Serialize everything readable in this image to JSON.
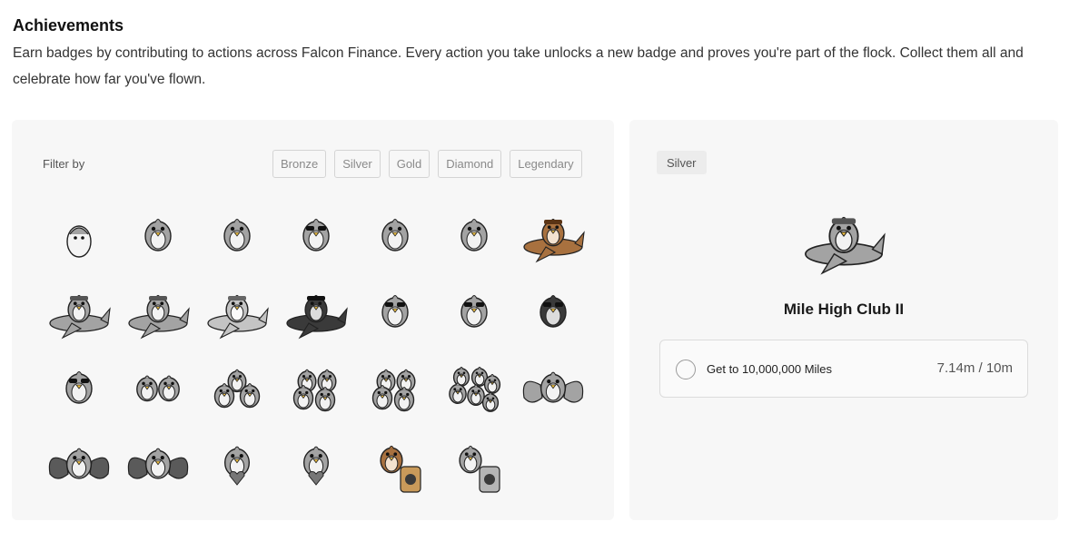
{
  "page": {
    "title": "Achievements",
    "description": "Earn badges by contributing to actions across Falcon Finance. Every action you take unlocks a new badge and proves you're part of the flock. Collect them all and celebrate how far you've flown."
  },
  "filter": {
    "label": "Filter by",
    "options": [
      "Bronze",
      "Silver",
      "Gold",
      "Diamond",
      "Legendary"
    ]
  },
  "badges": [
    {
      "icon": "egg-icon",
      "color": "gray"
    },
    {
      "icon": "bird-blanket-icon",
      "color": "gray"
    },
    {
      "icon": "bird-flannel-icon",
      "color": "gray"
    },
    {
      "icon": "bird-glasses-suit-icon",
      "color": "gray"
    },
    {
      "icon": "bird-leather-jacket-icon",
      "color": "gray"
    },
    {
      "icon": "bird-robot-icon",
      "color": "gray"
    },
    {
      "icon": "bird-plane-bronze-icon",
      "color": "bronze"
    },
    {
      "icon": "bird-plane-icon",
      "color": "gray"
    },
    {
      "icon": "bird-plane-icon",
      "color": "gray"
    },
    {
      "icon": "bird-jet-icon",
      "color": "light"
    },
    {
      "icon": "bird-jet-dark-icon",
      "color": "dark"
    },
    {
      "icon": "bird-scarf-glasses-icon",
      "color": "gray"
    },
    {
      "icon": "bird-scarf-glasses-icon",
      "color": "gray"
    },
    {
      "icon": "bird-hoodie-dark-icon",
      "color": "dark"
    },
    {
      "icon": "bird-hoodie-light-icon",
      "color": "gray"
    },
    {
      "icon": "bird-pair-icon",
      "color": "gray"
    },
    {
      "icon": "bird-group-three-icon",
      "color": "gray"
    },
    {
      "icon": "bird-group-four-icon",
      "color": "gray"
    },
    {
      "icon": "bird-group-five-icon",
      "color": "gray"
    },
    {
      "icon": "bird-flock-icon",
      "color": "gray"
    },
    {
      "icon": "bird-wings-icon",
      "color": "gray"
    },
    {
      "icon": "bird-butterfly-icon",
      "color": "gray"
    },
    {
      "icon": "bird-butterfly-icon",
      "color": "gray"
    },
    {
      "icon": "bird-heart-icon",
      "color": "gray"
    },
    {
      "icon": "bird-heart-icon",
      "color": "gray"
    },
    {
      "icon": "bird-honey-jar-bronze-icon",
      "color": "bronze"
    },
    {
      "icon": "bird-jar-icon",
      "color": "gray"
    }
  ],
  "detail": {
    "tier": "Silver",
    "title": "Mile High Club II",
    "icon": "bird-plane-icon",
    "task": {
      "label": "Get to 10,000,000 Miles",
      "progress": "7.14m / 10m"
    }
  },
  "colors": {
    "panel_bg": "#f7f7f7",
    "chip_border": "#d4d4d4",
    "gray_bird": "#9c9c9c",
    "bronze_bird": "#a06a3a",
    "dark_bird": "#2a2a2a"
  }
}
